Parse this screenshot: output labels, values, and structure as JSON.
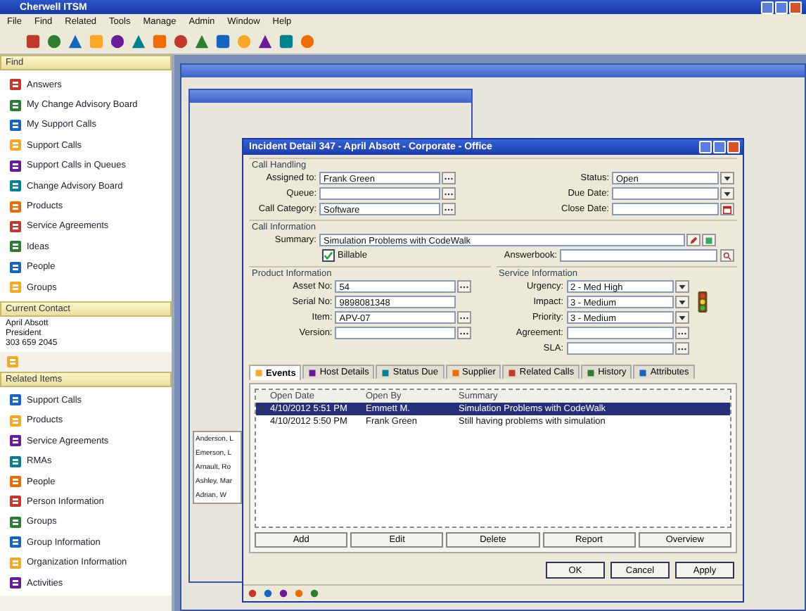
{
  "window": {
    "title": "Cherwell ITSM"
  },
  "menu": [
    "File",
    "Find",
    "Related",
    "Tools",
    "Manage",
    "Admin",
    "Window",
    "Help"
  ],
  "find_panel": {
    "title": "Find",
    "items": [
      {
        "label": "Answers"
      },
      {
        "label": "My Change Advisory Board"
      },
      {
        "label": "My Support Calls"
      },
      {
        "label": "Support Calls"
      },
      {
        "label": "Support Calls in Queues"
      },
      {
        "label": "Change Advisory Board"
      },
      {
        "label": "Products"
      },
      {
        "label": "Service Agreements"
      },
      {
        "label": "Ideas"
      },
      {
        "label": "People"
      },
      {
        "label": "Groups"
      }
    ]
  },
  "current_contact": {
    "title": "Current Contact",
    "lines": [
      "April Absott",
      "President",
      "303 659 2045"
    ]
  },
  "related_items": {
    "title": "Related Items",
    "items": [
      {
        "label": "Support Calls"
      },
      {
        "label": "Products"
      },
      {
        "label": "Service Agreements"
      },
      {
        "label": "RMAs"
      },
      {
        "label": "People"
      },
      {
        "label": "Person Information"
      },
      {
        "label": "Groups"
      },
      {
        "label": "Group Information"
      },
      {
        "label": "Organization Information"
      },
      {
        "label": "Activities"
      }
    ]
  },
  "background_list": [
    "Anderson, L",
    "Emerson, L",
    "Arnault, Ro",
    "Ashley, Mar",
    "Adrian, W"
  ],
  "dialog": {
    "title": "Incident Detail 347 - April Absott - Corporate - Office",
    "call_handling": {
      "title": "Call Handling",
      "left": [
        {
          "label": "Assigned to:",
          "value": "Frank Green",
          "kind": "lookup"
        },
        {
          "label": "Queue:",
          "kind": "lookup"
        },
        {
          "label": "Call Category:",
          "value": "Software",
          "kind": "lookup"
        }
      ],
      "right": [
        {
          "label": "Status:",
          "value": "Open",
          "kind": "dropdown"
        },
        {
          "label": "Due Date:",
          "kind": "dropdown"
        },
        {
          "label": "Close Date:",
          "kind": "calendar"
        }
      ]
    },
    "call_information": {
      "title": "Call Information",
      "summary_label": "Summary:",
      "summary": "Simulation Problems with CodeWalk",
      "billable": {
        "label": "Billable",
        "checked": true
      },
      "answerbook_label": "Answerbook:"
    },
    "product_information": {
      "title": "Product Information",
      "fields": [
        {
          "label": "Asset No:",
          "value": "54",
          "kind": "lookup"
        },
        {
          "label": "Serial No:",
          "value": "9898081348",
          "kind": "plain"
        },
        {
          "label": "Item:",
          "value": "APV-07",
          "kind": "lookup"
        },
        {
          "label": "Version:",
          "kind": "lookup"
        }
      ]
    },
    "service_information": {
      "title": "Service Information",
      "fields": [
        {
          "label": "Urgency:",
          "value": "2 - Med High",
          "kind": "dropdown"
        },
        {
          "label": "Impact:",
          "value": "3 - Medium",
          "kind": "dropdown"
        },
        {
          "label": "Priority:",
          "value": "3 - Medium",
          "kind": "dropdown"
        },
        {
          "label": "Agreement:",
          "kind": "lookup"
        },
        {
          "label": "SLA:",
          "kind": "lookup"
        }
      ]
    },
    "tabs": [
      {
        "label": "Events",
        "selected": true
      },
      {
        "label": "Host Details",
        "selected": false
      },
      {
        "label": "Status Due",
        "selected": false
      },
      {
        "label": "Supplier",
        "selected": false
      },
      {
        "label": "Related Calls",
        "selected": false
      },
      {
        "label": "History",
        "selected": false
      },
      {
        "label": "Attributes",
        "selected": false
      }
    ],
    "events": {
      "columns": [
        "Open Date",
        "Open By",
        "Summary"
      ],
      "rows": [
        {
          "cells": [
            "4/10/2012 5:51 PM",
            "Emmett M.",
            "Simulation Problems with CodeWalk"
          ],
          "selected": true
        },
        {
          "cells": [
            "4/10/2012 5:50 PM",
            "Frank Green",
            "Still having problems with simulation"
          ],
          "selected": false
        }
      ]
    },
    "event_buttons": [
      "Add",
      "Edit",
      "Delete",
      "Report",
      "Overview"
    ],
    "buttons": [
      "OK",
      "Cancel",
      "Apply"
    ]
  }
}
